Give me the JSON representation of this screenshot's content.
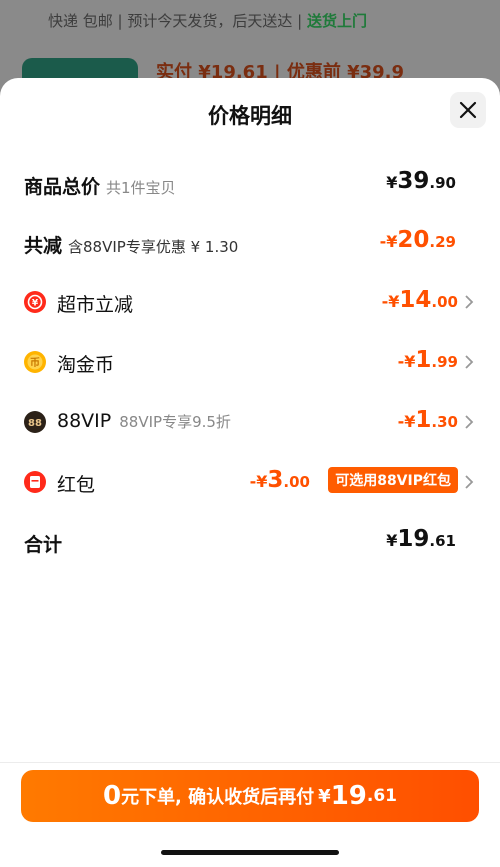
{
  "background_page": {
    "shipping_prefix": "快递 包邮 | 预计今天发货，后天送达 |",
    "shipping_highlight": "送货上门",
    "price_teaser": "实付 ¥19.61 | 优惠前 ¥39.9"
  },
  "sheet": {
    "title": "价格明细",
    "total": {
      "label": "商品总价",
      "sub": "共1件宝贝",
      "cur": "¥",
      "int": "39",
      "dec": ".90"
    },
    "discount": {
      "label": "共减",
      "sub": "含88VIP专享优惠 ¥ 1.30",
      "cur": "-¥",
      "int": "20",
      "dec": ".29"
    },
    "items": [
      {
        "name": "超市立减",
        "icon": "supermarket-discount-icon",
        "cur": "-¥",
        "int": "14",
        "dec": ".00"
      },
      {
        "name": "淘金币",
        "icon": "gold-coin-icon",
        "cur": "-¥",
        "int": "1",
        "dec": ".99"
      },
      {
        "name": "88VIP",
        "sub": "88VIP专享9.5折",
        "icon": "88vip-icon",
        "cur": "-¥",
        "int": "1",
        "dec": ".30"
      },
      {
        "name": "红包",
        "icon": "red-packet-icon",
        "cur": "-¥",
        "int": "3",
        "dec": ".00",
        "badge": "可选用88VIP红包"
      }
    ],
    "sum": {
      "label": "合计",
      "cur": "¥",
      "int": "19",
      "dec": ".61"
    },
    "pay_button": {
      "big": "0",
      "text": "元下单, 确认收货后再付",
      "cur": "¥",
      "int": "19",
      "dec": ".61"
    }
  },
  "colors": {
    "accent": "#ff5000",
    "badge": "#ff5c00",
    "green": "#1f7a3a"
  }
}
